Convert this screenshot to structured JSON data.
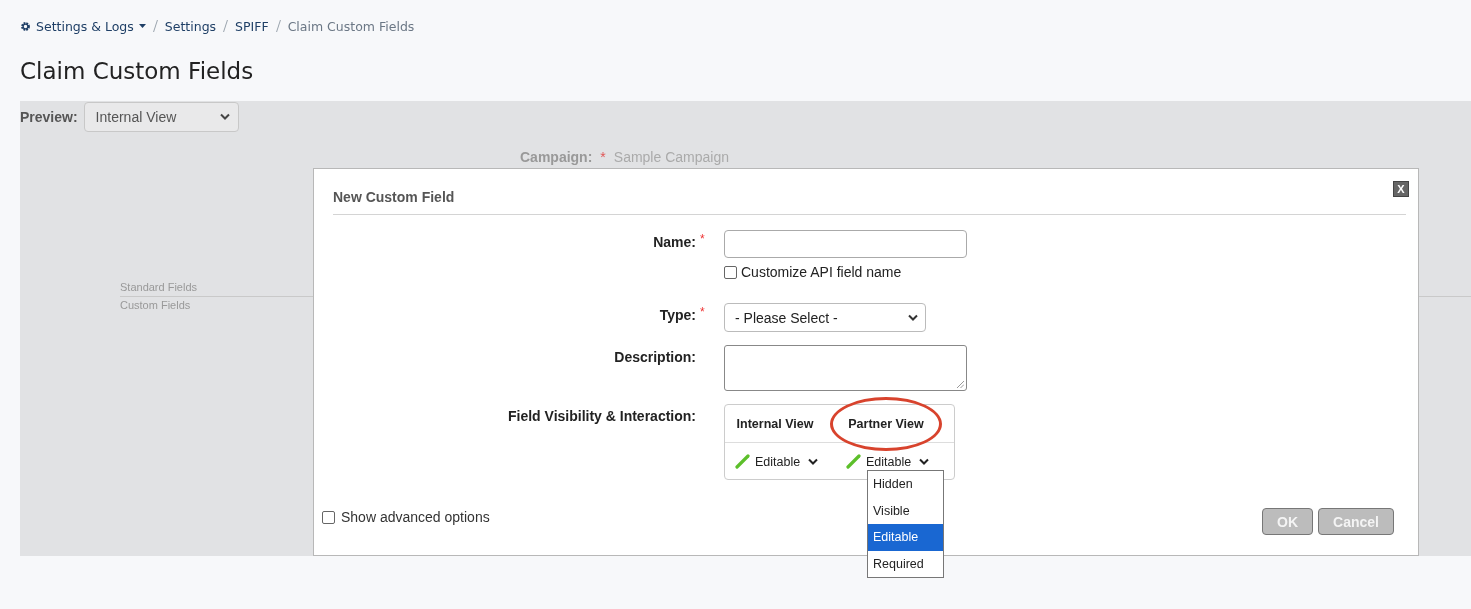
{
  "breadcrumb": [
    {
      "label": "Settings & Logs",
      "kind": "menu"
    },
    {
      "label": "Settings",
      "kind": "link"
    },
    {
      "label": "SPIFF",
      "kind": "link"
    },
    {
      "label": "Claim Custom Fields",
      "kind": "current"
    }
  ],
  "title": "Claim Custom Fields",
  "preview": {
    "label": "Preview:",
    "value": "Internal View"
  },
  "background_form": {
    "campaign_label": "Campaign:",
    "required_mark": "*",
    "campaign_value": "Sample Campaign",
    "sections": [
      "Standard Fields",
      "Custom Fields"
    ]
  },
  "dialog": {
    "title": "New Custom Field",
    "close": "X",
    "name": {
      "label": "Name:",
      "required_mark": "*",
      "checkbox_label": "Customize API field name",
      "checked": false
    },
    "type": {
      "label": "Type:",
      "required_mark": "*",
      "value": "- Please Select -"
    },
    "description": {
      "label": "Description:"
    },
    "visibility": {
      "label": "Field Visibility & Interaction:",
      "columns": [
        {
          "header": "Internal View",
          "value": "Editable",
          "circled": false
        },
        {
          "header": "Partner View",
          "value": "Editable",
          "circled": true
        }
      ]
    },
    "dropdown_options": [
      {
        "label": "Hidden",
        "selected": false
      },
      {
        "label": "Visible",
        "selected": false
      },
      {
        "label": "Editable",
        "selected": true
      },
      {
        "label": "Required",
        "selected": false
      }
    ],
    "advanced": {
      "label": "Show advanced options",
      "checked": false
    },
    "buttons": [
      {
        "label": "OK",
        "disabled": true
      },
      {
        "label": "Cancel",
        "disabled": true
      }
    ]
  }
}
